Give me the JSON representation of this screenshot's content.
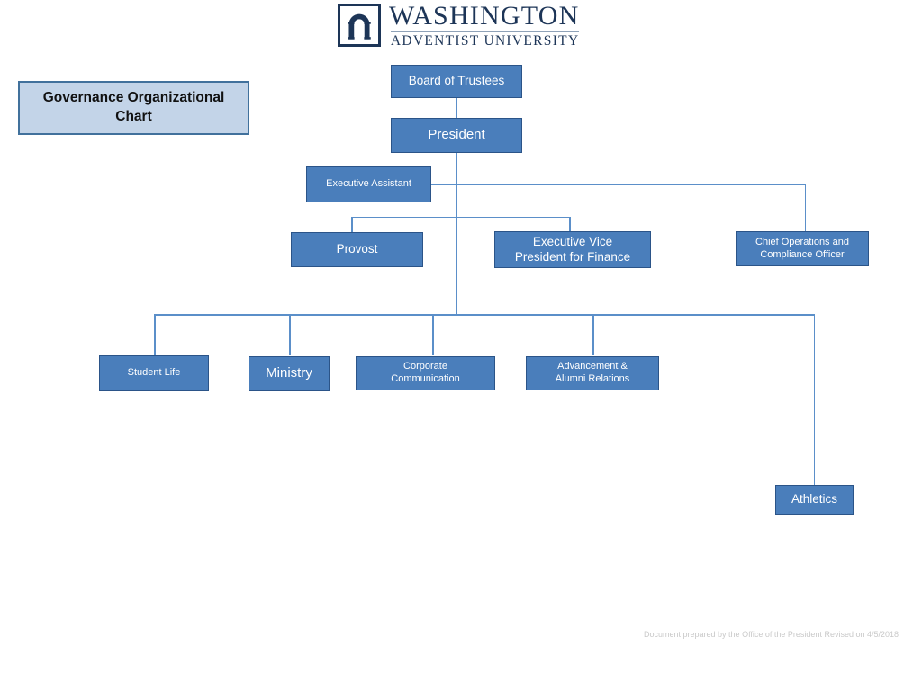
{
  "logo": {
    "icon": "arch-gateway-icon",
    "name": "WASHINGTON",
    "subtitle": "ADVENTIST UNIVERSITY",
    "color": "#1d3557"
  },
  "title": {
    "text": "Governance Organizational Chart",
    "fill": "#c3d4e8",
    "border": "#41719c"
  },
  "theme": {
    "node_fill": "#4a7ebb",
    "node_border": "#2b5488",
    "node_text": "#ffffff",
    "connector": "#5b8fc9",
    "background": "#ffffff"
  },
  "chart_data": {
    "type": "org-chart",
    "title": "Governance Organizational Chart",
    "nodes": [
      {
        "id": "board",
        "label": "Board of Trustees"
      },
      {
        "id": "president",
        "label": "President"
      },
      {
        "id": "exec_asst",
        "label": "Executive  Assistant"
      },
      {
        "id": "provost",
        "label": "Provost"
      },
      {
        "id": "evp_fin",
        "label": "Executive Vice\nPresident for Finance"
      },
      {
        "id": "coco",
        "label": "Chief Operations and\nCompliance  Officer"
      },
      {
        "id": "student",
        "label": "Student Life"
      },
      {
        "id": "ministry",
        "label": "Ministry"
      },
      {
        "id": "corpcomm",
        "label": "Corporate\nCommunication"
      },
      {
        "id": "advance",
        "label": "Advancement  &\nAlumni Relations"
      },
      {
        "id": "athletics",
        "label": "Athletics"
      }
    ],
    "edges": [
      {
        "from": "board",
        "to": "president"
      },
      {
        "from": "president",
        "to": "exec_asst"
      },
      {
        "from": "president",
        "to": "provost"
      },
      {
        "from": "president",
        "to": "evp_fin"
      },
      {
        "from": "exec_asst",
        "to": "coco"
      },
      {
        "from": "president",
        "to": "student"
      },
      {
        "from": "president",
        "to": "ministry"
      },
      {
        "from": "president",
        "to": "corpcomm"
      },
      {
        "from": "president",
        "to": "advance"
      },
      {
        "from": "president",
        "to": "athletics"
      }
    ]
  },
  "nodes": {
    "board": "Board of Trustees",
    "president": "President",
    "exec_asst": "Executive  Assistant",
    "provost": "Provost",
    "evp_fin": "Executive Vice\nPresident for Finance",
    "coco": "Chief Operations and\nCompliance  Officer",
    "student": "Student Life",
    "ministry": "Ministry",
    "corpcomm": "Corporate\nCommunication",
    "advance": "Advancement  &\nAlumni Relations",
    "athletics": "Athletics"
  },
  "footer": {
    "text": "Document prepared by the Office of the  President   Revised on  4/5/2018"
  }
}
